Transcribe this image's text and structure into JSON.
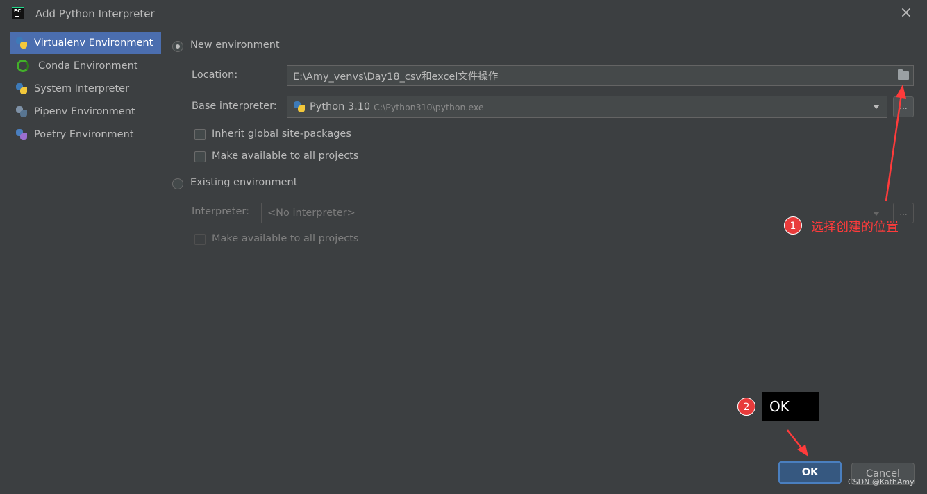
{
  "window": {
    "app_logo_text": "PC",
    "title": "Add Python Interpreter",
    "close_glyph": "×"
  },
  "sidebar": {
    "items": [
      {
        "label": "Virtualenv Environment",
        "icon": "python-icon",
        "selected": true
      },
      {
        "label": "Conda Environment",
        "icon": "conda-icon",
        "selected": false
      },
      {
        "label": "System Interpreter",
        "icon": "python-icon",
        "selected": false
      },
      {
        "label": "Pipenv Environment",
        "icon": "pipenv-icon",
        "selected": false
      },
      {
        "label": "Poetry Environment",
        "icon": "poetry-icon",
        "selected": false
      }
    ]
  },
  "new_env": {
    "radio_label": "New environment",
    "location_label": "Location:",
    "location_value": "E:\\Amy_venvs\\Day18_csv和excel文件操作",
    "base_label": "Base interpreter:",
    "base_name": "Python 3.10",
    "base_path": "C:\\Python310\\python.exe",
    "browse_label": "...",
    "inherit_label": "Inherit global site-packages",
    "make_available_label": "Make available to all projects"
  },
  "existing_env": {
    "radio_label": "Existing environment",
    "interpreter_label": "Interpreter:",
    "interpreter_value": "<No interpreter>",
    "browse_label": "...",
    "make_available_label": "Make available to all projects"
  },
  "annotations": {
    "badge1": "1",
    "text1": "选择创建的位置",
    "badge2": "2",
    "tip_text": "OK",
    "color": "#ff3b3b"
  },
  "buttons": {
    "ok": "OK",
    "cancel": "Cancel"
  },
  "watermark": "CSDN @KathAmy",
  "colors": {
    "background": "#3c3f41",
    "selection": "#4b6eaf",
    "ok_button": "#365880"
  }
}
